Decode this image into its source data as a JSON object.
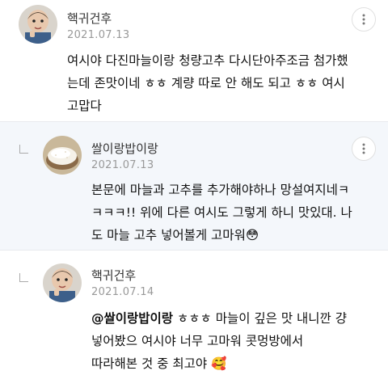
{
  "comments": [
    {
      "author": "핵귀건후",
      "date": "2021.07.13",
      "lines": [
        "여시야 다진마늘이랑 청량고추 다시단아주조금 첨가했",
        "는데 존맛이네 ㅎㅎ 계량 따로 안 해도 되고 ㅎㅎ 여시",
        "고맙다"
      ]
    },
    {
      "author": "쌀이랑밥이랑",
      "date": "2021.07.13",
      "lines": [
        "본문에 마늘과 고추를 추가해야하나 망설여지네ㅋ",
        "ㅋㅋㅋ!! 위에 다른 여시도 그렇게 하니 맛있대. 나",
        "도 마늘 고추 넣어볼게 고마워😳"
      ]
    },
    {
      "author": "핵귀건후",
      "date": "2021.07.14",
      "mention": "@쌀이랑밥이랑",
      "lines": [
        " ㅎㅎㅎ 마늘이 깊은 맛 내니깐 걍",
        "넣어봤으 여시야 너무 고마워 콧멍방에서",
        "따라해본 것 중 최고야 🥰"
      ]
    }
  ],
  "icons": {
    "more": "more-vertical-icon",
    "reply": "reply-arrow-icon"
  },
  "colors": {
    "reply_background": "#f4f7fb",
    "date": "#999999"
  }
}
